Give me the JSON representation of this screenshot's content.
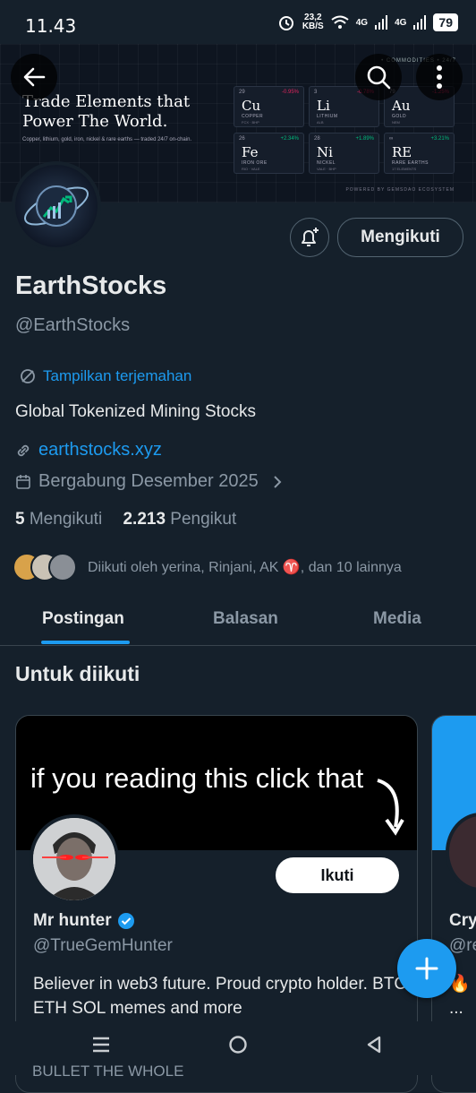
{
  "status": {
    "time": "11.43",
    "speed_top": "23,2",
    "speed_unit": "KB/S",
    "net1": "4G",
    "net2": "4G",
    "battery": "79"
  },
  "banner": {
    "headline": "Trade Elements that Power The World.",
    "sub": "Copper, lithium, gold, iron, nickel & rare earths — traded 24/7 on-chain.",
    "topnote": "• COMMODITIES • 24/7",
    "powered": "POWERED BY GEMSDAO ECOSYSTEM",
    "tiles": [
      {
        "num": "29",
        "change": "-0.95%",
        "color": "#e0245e",
        "sym": "Cu",
        "name": "COPPER",
        "tick": "FCX · BHP"
      },
      {
        "num": "3",
        "change": "-0.78%",
        "color": "#e0245e",
        "sym": "Li",
        "name": "LITHIUM",
        "tick": "ALB"
      },
      {
        "num": "79",
        "change": "-1.25%",
        "color": "#e0245e",
        "sym": "Au",
        "name": "GOLD",
        "tick": "NEM"
      },
      {
        "num": "26",
        "change": "+2.34%",
        "color": "#00ba7c",
        "sym": "Fe",
        "name": "IRON ORE",
        "tick": "RIO · VALE"
      },
      {
        "num": "28",
        "change": "+1.89%",
        "color": "#00ba7c",
        "sym": "Ni",
        "name": "NICKEL",
        "tick": "VALE · BHP"
      },
      {
        "num": "∞",
        "change": "+3.21%",
        "color": "#00ba7c",
        "sym": "RE",
        "name": "RARE EARTHS",
        "tick": "17 ELEMENTS"
      }
    ]
  },
  "profile": {
    "follow_label": "Mengikuti",
    "name": "EarthStocks",
    "handle": "@EarthStocks",
    "translate": "Tampilkan terjemahan",
    "bio": "Global Tokenized Mining Stocks",
    "link": "earthstocks.xyz",
    "joined": "Bergabung Desember 2025",
    "following_count": "5",
    "following_label": "Mengikuti",
    "followers_count": "2.213",
    "followers_label": "Pengikut",
    "followed_by": "Diikuti oleh yerina, Rinjani, AK ♈, dan 10 lainnya"
  },
  "tabs": [
    "Postingan",
    "Balasan",
    "Media"
  ],
  "suggestions": {
    "title": "Untuk diikuti",
    "cards": [
      {
        "banner_text": "if you reading this click that",
        "follow_label": "Ikuti",
        "name": "Mr hunter",
        "handle": "@TrueGemHunter",
        "bio": "Believer in web3 future. Proud crypto holder. BTC ETH SOL memes and more"
      }
    ],
    "peek": {
      "name": "Cry",
      "handle": "@re",
      "bio": "🔥 I",
      "more": "..."
    }
  },
  "peek_text": "BULLET THE WHOLE"
}
